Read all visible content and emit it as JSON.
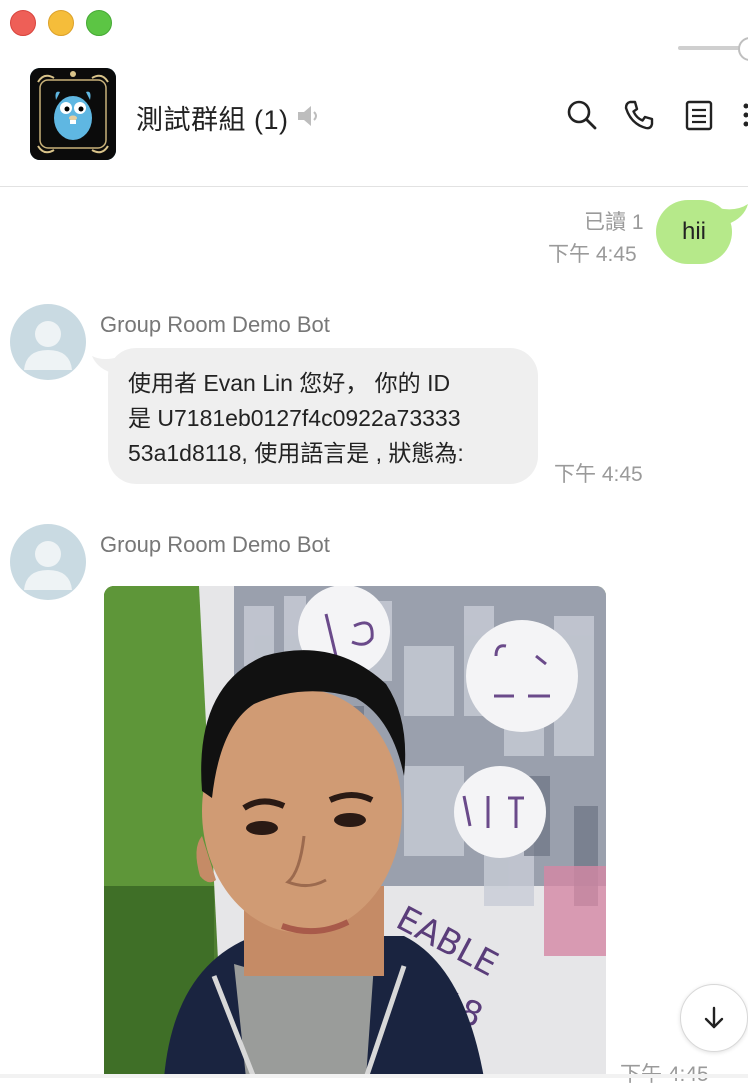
{
  "window": {
    "controls": [
      "close",
      "minimize",
      "zoom"
    ]
  },
  "header": {
    "title": "測試群組 (1)",
    "icons": [
      "speaker-muted-icon",
      "search-icon",
      "phone-icon",
      "notes-icon",
      "more-icon"
    ]
  },
  "messages": {
    "outgoing": {
      "read_status": "已讀 1",
      "time": "下午 4:45",
      "text": "hii"
    },
    "bot_text": {
      "sender": "Group Room Demo Bot",
      "lines": [
        "使用者 Evan Lin 您好， 你的 ID",
        "是 U7181eb0127f4c0922a73333",
        "53a1d8118, 使用語言是 , 狀態為:"
      ],
      "time": "下午 4:45"
    },
    "bot_image": {
      "sender": "Group Room Demo Bot",
      "time": "下午 4:45"
    }
  },
  "colors": {
    "outgoing_bubble": "#b6e98a",
    "incoming_bubble": "#efefef",
    "meta_text": "#9a9a9a"
  }
}
